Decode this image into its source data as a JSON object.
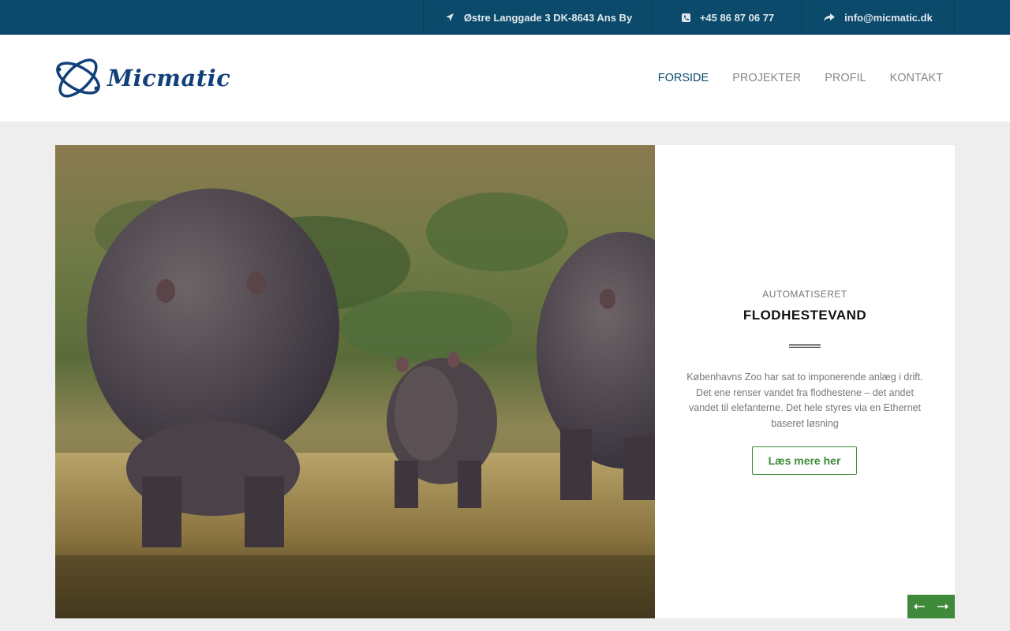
{
  "topbar": {
    "address": "Østre Langgade 3 DK-8643 Ans By",
    "phone": "+45 86 87 06 77",
    "email": "info@micmatic.dk",
    "icons": [
      "location-arrow-icon",
      "phone-icon",
      "share-icon"
    ]
  },
  "header": {
    "logo_text": "Micmatic",
    "nav": [
      {
        "label": "FORSIDE",
        "active": true
      },
      {
        "label": "PROJEKTER",
        "active": false
      },
      {
        "label": "PROFIL",
        "active": false
      },
      {
        "label": "KONTAKT",
        "active": false
      }
    ]
  },
  "slide": {
    "pretitle": "AUTOMATISERET",
    "title": "FLODHESTEVAND",
    "description": "Københavns Zoo har sat to imponerende anlæg i drift. Det ene renser vandet fra flodhestene – det andet vandet til elefanterne. Det hele styres via en Ethernet baseret løsning",
    "button_label": "Læs mere her"
  },
  "colors": {
    "topbar": "#0b4a6b",
    "accent_green": "#3f8a3a",
    "brand_blue": "#11407a",
    "background": "#eeeeee"
  }
}
